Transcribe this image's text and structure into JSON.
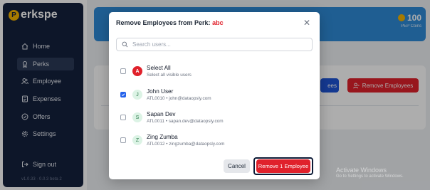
{
  "sidebar": {
    "brand": "erkspe",
    "brand_mark": "P",
    "items": [
      {
        "label": "Home",
        "icon": "home-icon"
      },
      {
        "label": "Perks",
        "icon": "gift-icon"
      },
      {
        "label": "Employee",
        "icon": "users-icon"
      },
      {
        "label": "Expenses",
        "icon": "receipt-icon"
      },
      {
        "label": "Offers",
        "icon": "tag-icon"
      },
      {
        "label": "Settings",
        "icon": "gear-icon"
      }
    ],
    "active": "Perks",
    "signout": "Sign out",
    "version": "v1.0.33 · 0.0.3 beta 2"
  },
  "banner": {
    "coin_value": "100",
    "coin_label": "PEP Coins"
  },
  "background_card": {
    "blue_button": "ees",
    "red_button": "Remove Employees"
  },
  "modal": {
    "title": "Remove Employees from Perk:",
    "perk_name": "abc",
    "search_placeholder": "Search users...",
    "select_all": {
      "avatar": "A",
      "name": "Select All",
      "subtitle": "Select all visible users",
      "checked": false
    },
    "users": [
      {
        "avatar": "J",
        "name": "John User",
        "id": "ATL0010",
        "email": "john@dataopsly.com",
        "checked": true
      },
      {
        "avatar": "S",
        "name": "Sapan Dev",
        "id": "ATL0011",
        "email": "sapan.dev@dataopsly.com",
        "checked": false
      },
      {
        "avatar": "Z",
        "name": "Zing Zumba",
        "id": "ATL0012",
        "email": "zingzumba@dataopsly.com",
        "checked": false
      }
    ],
    "cancel": "Cancel",
    "remove": "Remove 1 Employee",
    "separator": "•"
  },
  "watermark": {
    "title": "Activate Windows",
    "subtitle": "Go to Settings to activate Windows."
  },
  "colors": {
    "sidebar": "#14213d",
    "accent_red": "#e0212b",
    "accent_blue": "#2f8bd8",
    "check_blue": "#2563eb"
  }
}
